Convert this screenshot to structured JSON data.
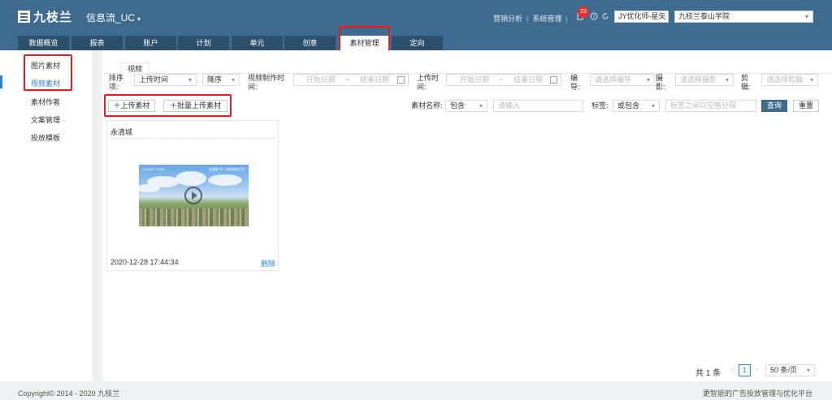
{
  "header": {
    "logo_text": "九枝兰",
    "app_title": "信息流_UC",
    "links": [
      "营销分析",
      "系统管理"
    ],
    "notification_count": "23",
    "account_select": "JY优化师-星矢",
    "org_select": "九枝兰泰山学院"
  },
  "tabs": [
    {
      "label": "数据概览"
    },
    {
      "label": "报表"
    },
    {
      "label": "账户"
    },
    {
      "label": "计划"
    },
    {
      "label": "单元"
    },
    {
      "label": "创意"
    },
    {
      "label": "素材管理",
      "active": true
    },
    {
      "label": "定向"
    }
  ],
  "sidebar": {
    "items": [
      {
        "label": "图片素材"
      },
      {
        "label": "视频素材",
        "active": true
      },
      {
        "label": "素材作者"
      },
      {
        "label": "文案管理"
      },
      {
        "label": "投放模板"
      }
    ]
  },
  "content": {
    "subtab": "视频",
    "filters": {
      "sort_label": "排序项:",
      "sort_field": "上传时间",
      "sort_order": "降序",
      "video_time_label": "视频制作时间:",
      "start_date_ph": "开始日期",
      "end_date_ph": "结束日期",
      "upload_time_label": "上传时间:",
      "editor_label": "编导:",
      "editor_ph": "请选择编导",
      "photo_label": "摄影:",
      "photo_ph": "请选择摄影",
      "cut_label": "剪辑:",
      "cut_ph": "请选择剪辑",
      "name_label": "素材名称:",
      "name_mode": "包含",
      "name_ph": "请输入",
      "tag_label": "标签:",
      "tag_mode": "或包含",
      "tag_ph": "标签之间以空格分隔",
      "query_button": "查询",
      "reset_button": "重置"
    },
    "upload_button": "上传素材",
    "batch_upload_button": "批量上传素材",
    "card": {
      "title": "永清城",
      "date": "2020-12-28 17:44:34",
      "delete_label": "删除",
      "thumb_text_left": "CHANG YONG",
      "thumb_text_right": "永清城 不一样的城市生活"
    },
    "pagination": {
      "total": "共 1 条",
      "current_page": "1",
      "page_size": "50 条/页"
    }
  },
  "footer": {
    "copyright": "Copyright© 2014 - 2020 九枝兰",
    "slogan": "更智能的广告投放管理与优化平台"
  }
}
